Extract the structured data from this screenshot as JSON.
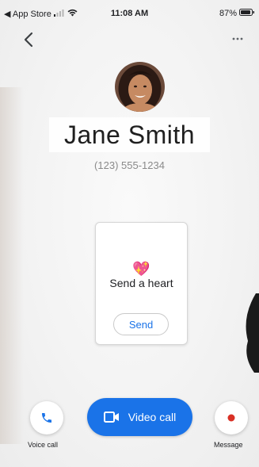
{
  "status_bar": {
    "back_app": "◀ App Store",
    "time": "11:08 AM",
    "battery": "87%"
  },
  "contact": {
    "name": "Jane Smith",
    "phone": "(123) 555-1234"
  },
  "heart_card": {
    "emoji": "💖",
    "title": "Send a heart",
    "send_label": "Send"
  },
  "actions": {
    "voice_call_label": "Voice call",
    "video_call_label": "Video call",
    "message_label": "Message"
  },
  "colors": {
    "accent": "#1a73e8",
    "record_red": "#d93025"
  }
}
